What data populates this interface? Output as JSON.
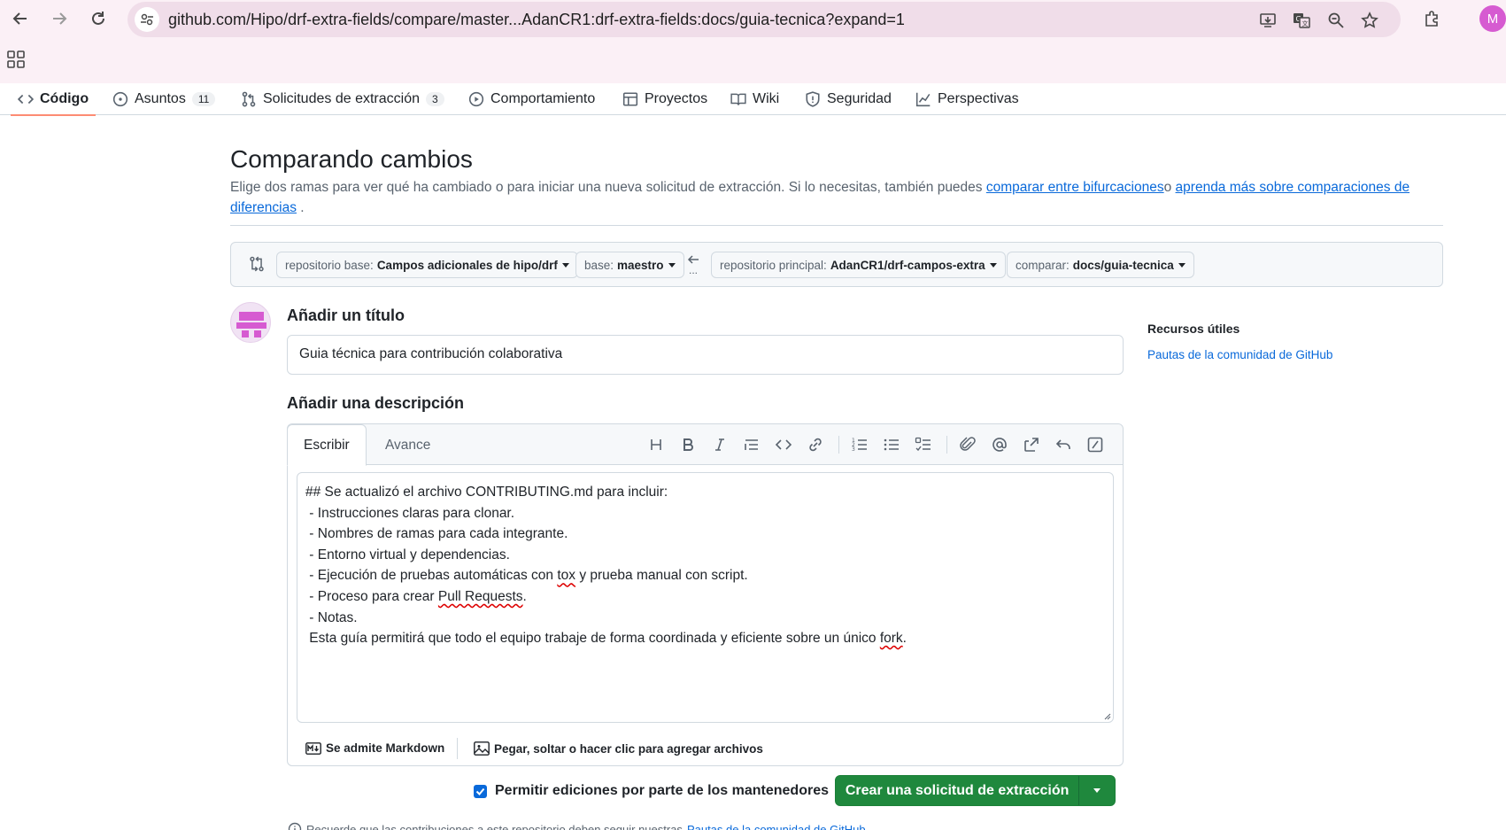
{
  "browser": {
    "url": "github.com/Hipo/drf-extra-fields/compare/master...AdanCR1:drf-extra-fields:docs/guia-tecnica?expand=1",
    "profile_initial": "M"
  },
  "repo_tabs": [
    {
      "label": "Código"
    },
    {
      "label": "Asuntos",
      "count": "11"
    },
    {
      "label": "Solicitudes de extracción",
      "count": "3"
    },
    {
      "label": "Comportamiento"
    },
    {
      "label": "Proyectos"
    },
    {
      "label": "Wiki"
    },
    {
      "label": "Seguridad"
    },
    {
      "label": "Perspectivas"
    }
  ],
  "page": {
    "title": "Comparando cambios",
    "desc_text": "Elige dos ramas para ver qué ha cambiado o para iniciar una nueva solicitud de extracción. Si lo necesitas, también puedes ",
    "link_forks": "comparar entre bifurcaciones",
    "desc_or": "o ",
    "link_learn": "aprenda más sobre comparaciones de diferencias",
    "desc_end": " ."
  },
  "range": {
    "base_repo_label": "repositorio base:",
    "base_repo": "Campos adicionales de hipo/drf",
    "base_label": "base:",
    "base": "maestro",
    "head_repo_label": "repositorio principal:",
    "head_repo": "AdanCR1/drf-campos-extra",
    "compare_label": "comparar:",
    "compare": "docs/guia-tecnica",
    "dots": "..."
  },
  "form": {
    "title_label": "Añadir un título",
    "title_value": "Guia técnica para contribución colaborativa",
    "desc_label": "Añadir una descripción",
    "tab_write": "Escribir",
    "tab_preview": "Avance",
    "body_lines": [
      "## Se actualizó el archivo CONTRIBUTING.md para incluir:",
      " - Instrucciones claras para clonar.",
      " - Nombres de ramas para cada integrante.",
      " - Entorno virtual y dependencias.",
      " - Ejecución de pruebas automáticas con ",
      " - Proceso para crear ",
      " - Notas.",
      " Esta guía permitirá que todo el equipo trabaje de forma coordinada y eficiente sobre un único "
    ],
    "line5_tox": "tox",
    "line5_rest": " y prueba manual con script.",
    "line6_pr": "Pull Requests",
    "line6_end": ".",
    "line8_fork": "fork",
    "line8_end": ".",
    "markdown_note": "Se admite Markdown",
    "attach_note": "Pegar, soltar o hacer clic para agregar archivos",
    "allow_edits": "Permitir ediciones por parte de los mantenedores",
    "allow_edits_checked": true,
    "help_glyph": "?",
    "create_button": "Crear una solicitud de extracción"
  },
  "sidebar": {
    "title": "Recursos útiles",
    "link": "Pautas de la comunidad de GitHub"
  },
  "footer": {
    "text": "Recuerde que las contribuciones a este repositorio deben seguir nuestras ",
    "link": "Pautas de la comunidad de GitHub",
    "end": "."
  },
  "icons": [
    "back-icon",
    "forward-icon",
    "reload-icon",
    "site-settings-icon",
    "install-icon",
    "translate-icon",
    "zoom-icon",
    "star-icon",
    "extensions-icon",
    "apps-grid-icon",
    "code-icon",
    "issue-icon",
    "pull-request-icon",
    "play-icon",
    "table-icon",
    "book-icon",
    "shield-icon",
    "graph-icon",
    "compare-icon",
    "arrow-left-icon",
    "heading-icon",
    "bold-icon",
    "italic-icon",
    "quote-icon",
    "link-icon",
    "ordered-list-icon",
    "unordered-list-icon",
    "tasklist-icon",
    "paperclip-icon",
    "mention-icon",
    "cross-reference-icon",
    "reply-icon",
    "slash-icon",
    "markdown-icon",
    "image-icon",
    "info-icon"
  ],
  "colors": {
    "primary_button": "#1f883d",
    "link": "#0969da",
    "tab_underline": "#fd8c73",
    "avatar_accent": "#d65bd1"
  }
}
